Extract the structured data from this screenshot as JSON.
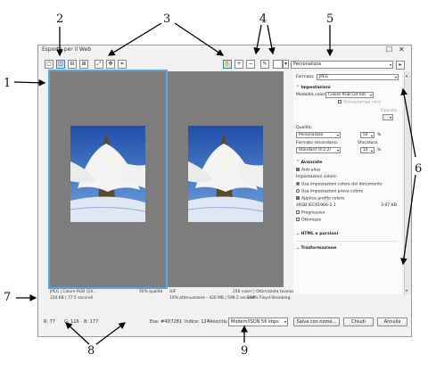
{
  "callouts": [
    "1",
    "2",
    "3",
    "4",
    "5",
    "6",
    "7",
    "8",
    "9"
  ],
  "window": {
    "title": "Esporta per il Web",
    "maximize_glyph": "☐",
    "close_glyph": "✕"
  },
  "toolbar": {
    "preset_select": "Personalizza",
    "icons": [
      "single-view-icon",
      "dual-view-icon",
      "vertical-split-icon",
      "quad-view-icon",
      "fit-icon",
      "pan-icon",
      "crop-icon",
      "hand-icon",
      "zoom-in-icon",
      "zoom-out-icon",
      "eyedropper-icon",
      "color-swatch-icon",
      "dropdown-icon",
      "next-icon"
    ]
  },
  "panes": {
    "left": {
      "line1_left": "JPEG  |  Colore RGB (24...",
      "line1_right": "50% qualità",
      "line2_left": "330 KB  |  77.5 secondi",
      "line2_right": ""
    },
    "right": {
      "line1_left": "GIF",
      "line1_right": "256 colori  |  Ottimizzata tavolozza",
      "line2_left": "10% attenuazione - 420 MB  |  599.2 secondi",
      "line2_right": "100% Floyd-Steinberg"
    }
  },
  "settings": {
    "format_label": "Formato:",
    "format_value": "JPEG",
    "section_settings": "Impostazioni",
    "color_mode_label": "Modalità colore:",
    "color_mode_value": "Colore RGB (24 bit)",
    "overprint_black": "Sovrastampa nero",
    "opacity_label": "Opacità:",
    "quality_label": "Qualità:",
    "quality_preset": "Personalizza",
    "quality_value": "50",
    "percent": "%",
    "sub_format_label": "Formato secondario:",
    "blur_label": "Sfocatura:",
    "sub_format_value": "Standard (4:2:2)",
    "blur_value": "10",
    "section_advanced": "Avanzate",
    "anti_alias": "Anti-alias",
    "color_settings_label": "Impostazioni colore:",
    "use_doc_color": "Usa impostazioni colore del documento",
    "use_proof_color": "Usa impostazioni prova colore",
    "apply_profile": "Applica profilo colore",
    "profile_name": "sRGB IEC61966-2.1",
    "profile_size": "3.07 KB",
    "progressive": "Progressivo",
    "optimize": "Ottimizza",
    "section_html": "HTML e porzioni",
    "section_transform": "Trasformazione"
  },
  "status": {
    "r": "R: 77",
    "g": "G: 116",
    "b": "B: 177",
    "hex": "Esa: #4D7281",
    "index": "Indice: 124",
    "speed_label": "Velocità:",
    "speed_value": "Modem/ISDN 56 kbps",
    "save_as": "Salva con nome...",
    "close": "Chiudi",
    "cancel": "Annulla"
  }
}
